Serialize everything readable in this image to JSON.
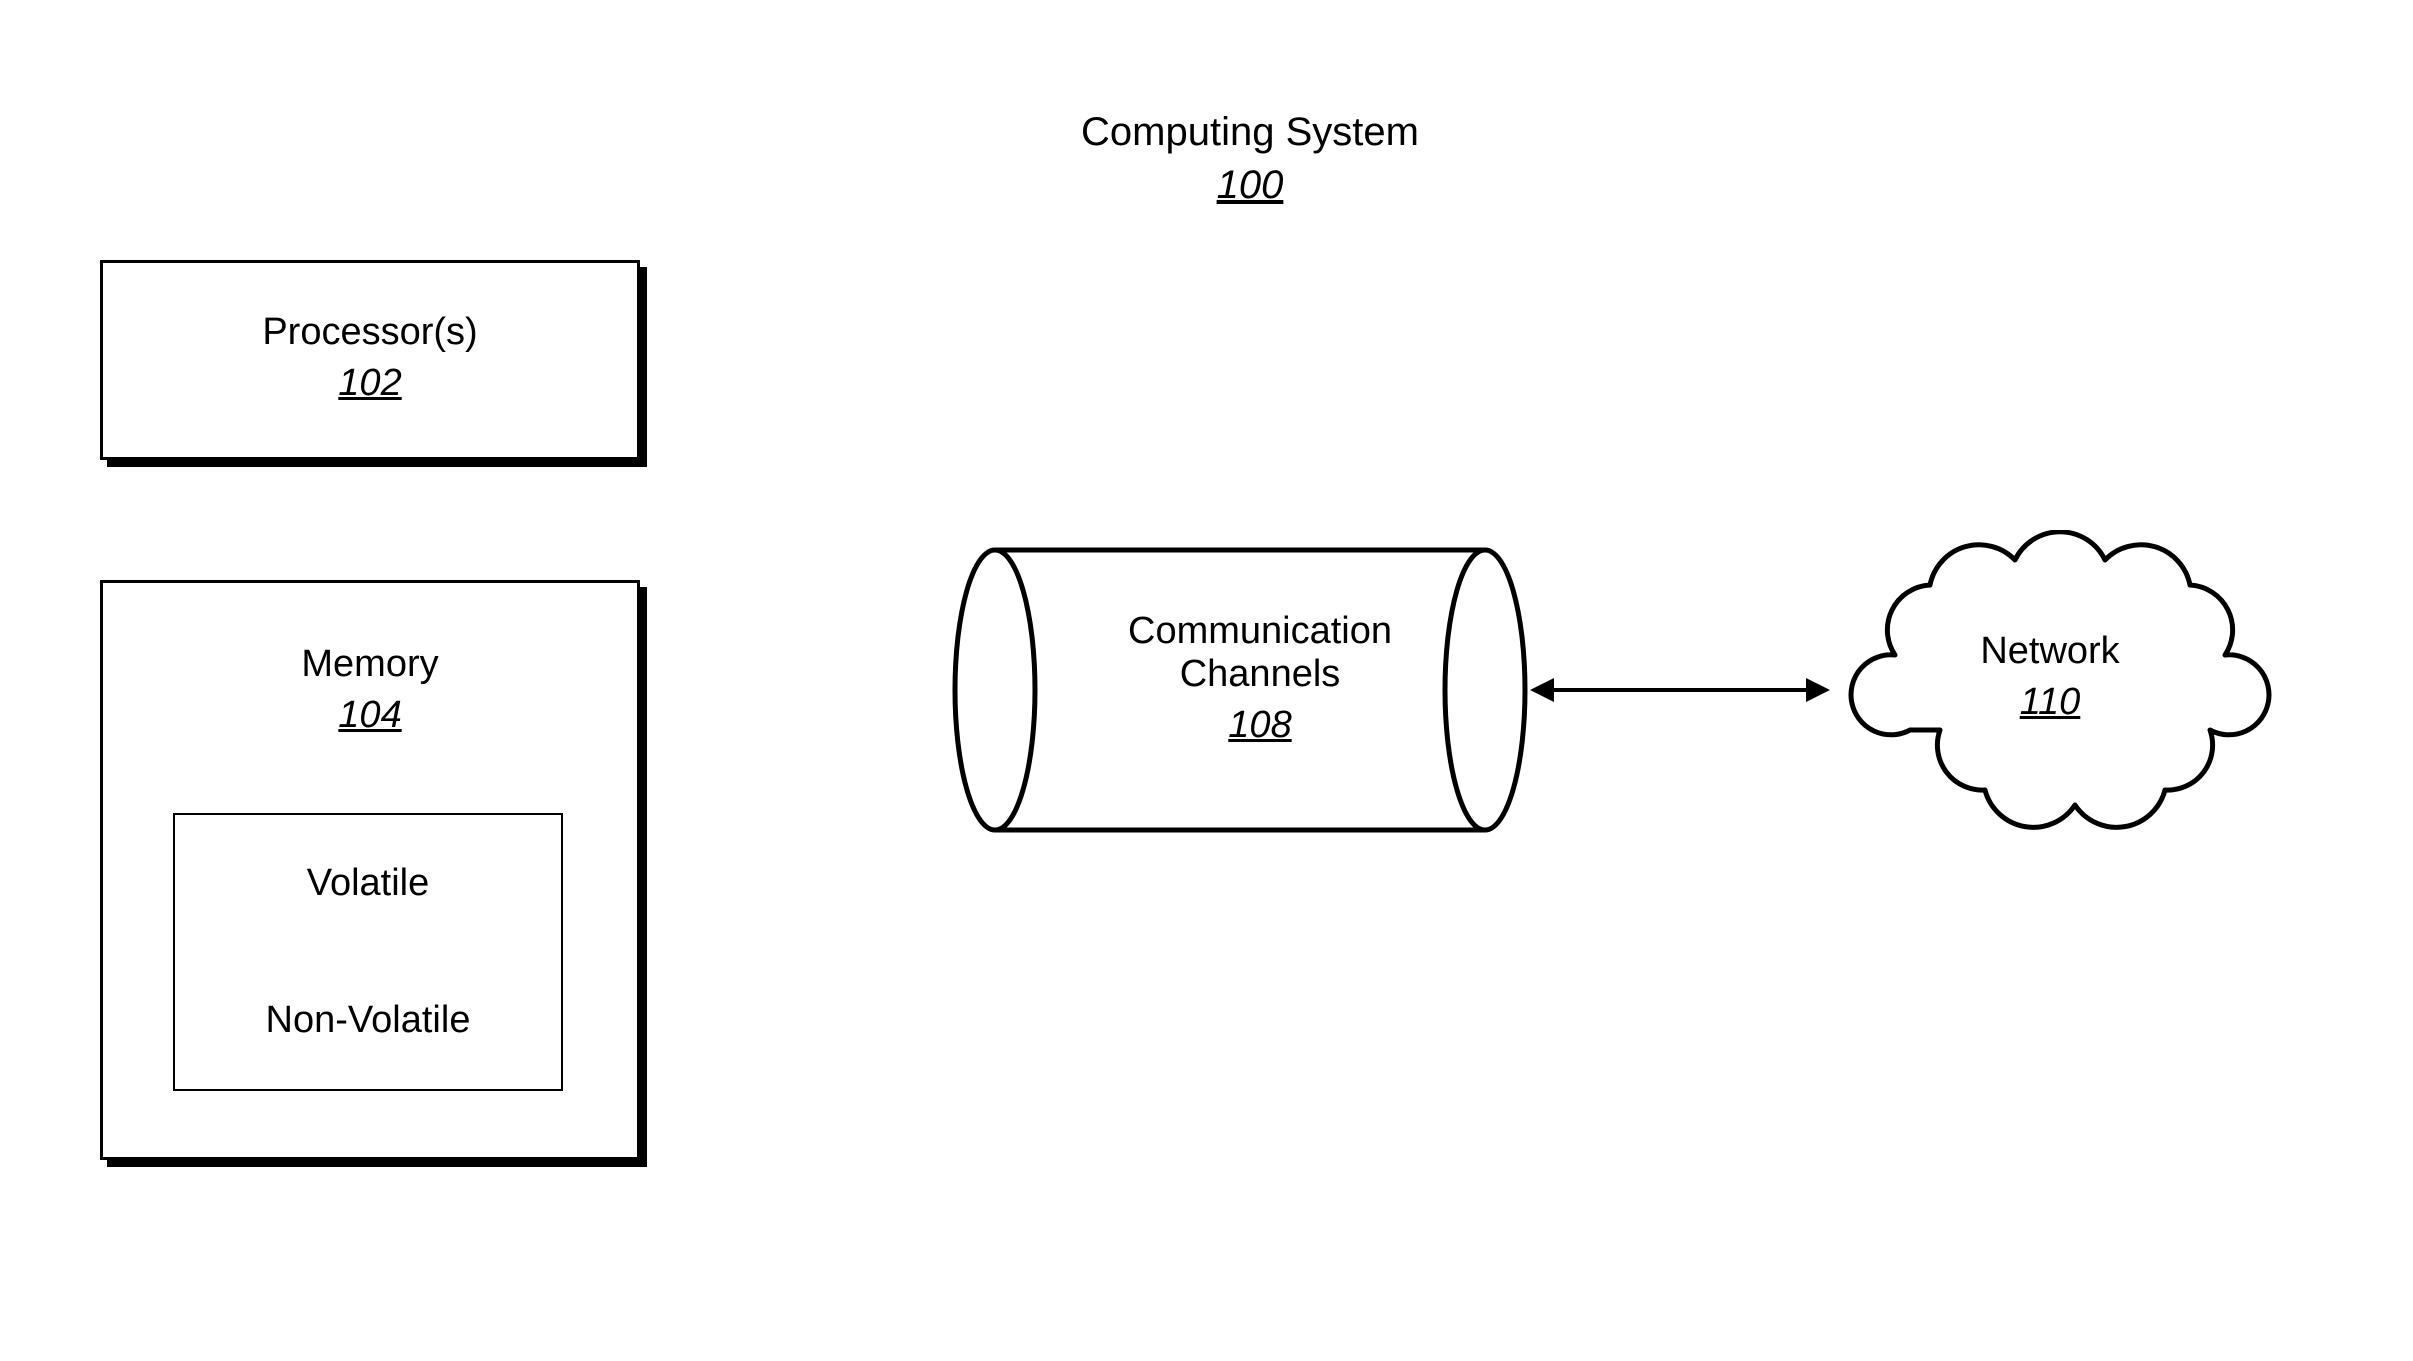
{
  "diagram": {
    "title": "Computing System",
    "title_ref": "100",
    "processor": {
      "label": "Processor(s)",
      "ref": "102"
    },
    "memory": {
      "label": "Memory",
      "ref": "104",
      "volatile": "Volatile",
      "nonvolatile": "Non-Volatile"
    },
    "channels": {
      "label1": "Communication",
      "label2": "Channels",
      "ref": "108"
    },
    "network": {
      "label": "Network",
      "ref": "110"
    }
  }
}
